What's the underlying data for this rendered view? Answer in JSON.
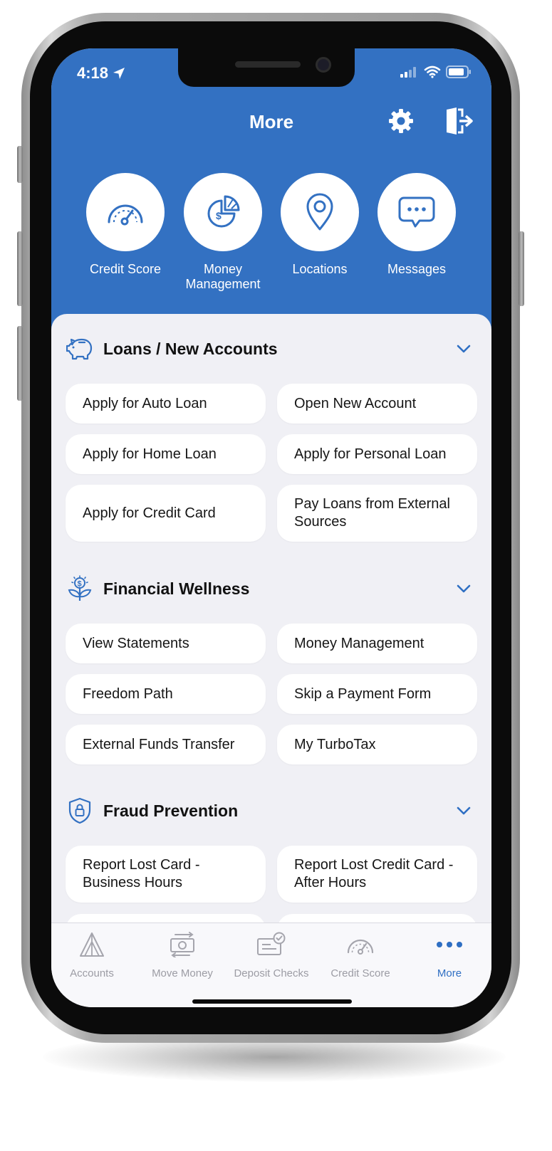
{
  "status_bar": {
    "time": "4:18"
  },
  "header": {
    "title": "More",
    "color": "#3371c2",
    "quick_actions": [
      {
        "label": "Credit Score",
        "icon": "speedometer-icon"
      },
      {
        "label": "Money Management",
        "icon": "pie-chart-dollar-icon"
      },
      {
        "label": "Locations",
        "icon": "map-pin-icon"
      },
      {
        "label": "Messages",
        "icon": "chat-bubble-icon"
      }
    ]
  },
  "sections": [
    {
      "title": "Loans / New Accounts",
      "icon": "piggy-bank-icon",
      "items": [
        "Apply for Auto Loan",
        "Open New Account",
        "Apply for Home Loan",
        "Apply for Personal Loan",
        "Apply for Credit Card",
        "Pay Loans from External Sources"
      ]
    },
    {
      "title": "Financial Wellness",
      "icon": "money-plant-icon",
      "items": [
        "View Statements",
        "Money Management",
        "Freedom Path",
        "Skip a Payment Form",
        "External Funds Transfer",
        "My TurboTax"
      ]
    },
    {
      "title": "Fraud Prevention",
      "icon": "shield-lock-icon",
      "items": [
        "Report Lost Card - Business Hours",
        "Report Lost Credit Card - After Hours"
      ]
    }
  ],
  "tab_bar": {
    "active": "More",
    "active_color": "#2f6fc3",
    "tabs": [
      {
        "label": "Accounts",
        "icon": "accounts-logo-icon"
      },
      {
        "label": "Move Money",
        "icon": "transfer-money-icon"
      },
      {
        "label": "Deposit Checks",
        "icon": "check-deposit-icon"
      },
      {
        "label": "Credit Score",
        "icon": "speedometer-icon"
      },
      {
        "label": "More",
        "icon": "more-dots-icon"
      }
    ]
  }
}
